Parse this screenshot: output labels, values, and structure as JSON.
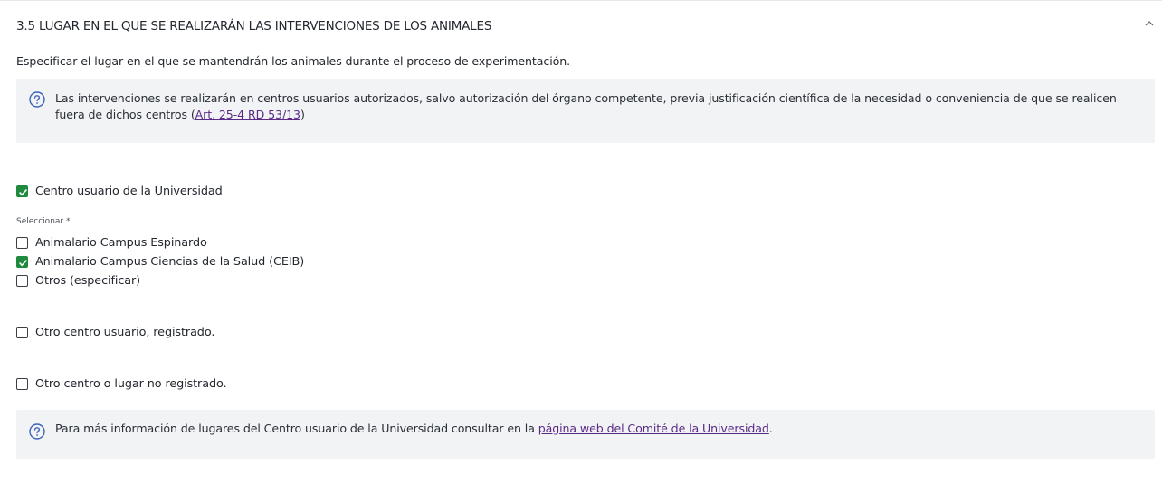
{
  "section": {
    "title": "3.5 LUGAR EN EL QUE SE REALIZARÁN LAS INTERVENCIONES DE LOS ANIMALES",
    "description": "Especificar el lugar en el que se mantendrán los animales durante el proceso de experimentación.",
    "collapse_icon": "chevron-up-icon"
  },
  "info1": {
    "icon": "question-circle-icon",
    "text_before": "Las intervenciones se realizarán en centros usuarios autorizados, salvo autorización del órgano competente, previa justificación científica de la necesidad o conveniencia de que se realicen fuera de dichos centros (",
    "link": "Art. 25-4 RD 53/13",
    "text_after": ")"
  },
  "options": {
    "centro_universidad": {
      "label": "Centro usuario de la Universidad",
      "checked": true
    },
    "select_label": "Seleccionar *",
    "sub": [
      {
        "label": "Animalario Campus Espinardo",
        "checked": false
      },
      {
        "label": "Animalario Campus Ciencias de la Salud (CEIB)",
        "checked": true
      },
      {
        "label": "Otros (especificar)",
        "checked": false
      }
    ],
    "otro_registrado": {
      "label": "Otro centro usuario, registrado.",
      "checked": false
    },
    "otro_no_registrado": {
      "label": "Otro centro o lugar no registrado.",
      "checked": false
    }
  },
  "info2": {
    "icon": "question-circle-icon",
    "text_before": "Para más información de lugares del Centro usuario de la Universidad consultar en la ",
    "link": "página web del Comité de la Universidad",
    "text_after": "."
  },
  "colors": {
    "accent_check": "#1f8a3e",
    "info_bg": "#f1f3f5",
    "link": "#5b2a86",
    "icon": "#3d63b8"
  }
}
